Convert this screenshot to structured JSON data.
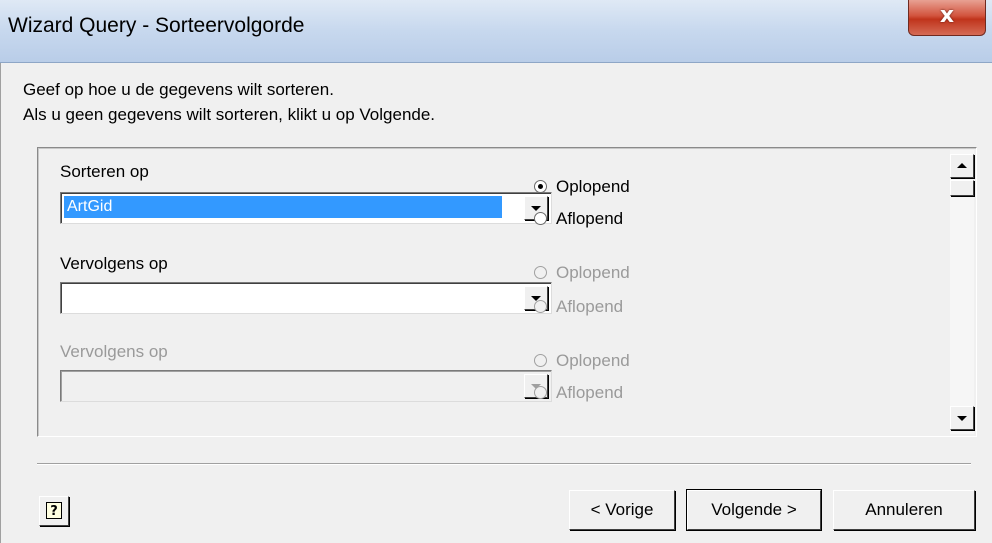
{
  "window": {
    "title": "Wizard Query - Sorteervolgorde",
    "close_label": "x"
  },
  "intro": {
    "line1": "Geef op hoe u de gegevens wilt sorteren.",
    "line2": "Als u geen gegevens wilt sorteren, klikt u op Volgende."
  },
  "sort_groups": [
    {
      "label": "Sorteren op",
      "value": "ArtGid",
      "enabled": true,
      "options": {
        "asc": "Oplopend",
        "desc": "Aflopend"
      },
      "selected": "asc"
    },
    {
      "label": "Vervolgens op",
      "value": "",
      "enabled": true,
      "options": {
        "asc": "Oplopend",
        "desc": "Aflopend"
      },
      "selected": null
    },
    {
      "label": "Vervolgens op",
      "value": "",
      "enabled": false,
      "options": {
        "asc": "Oplopend",
        "desc": "Aflopend"
      },
      "selected": null
    }
  ],
  "buttons": {
    "help": "?",
    "prev": "< Vorige",
    "next": "Volgende >",
    "cancel": "Annuleren"
  },
  "colors": {
    "selection": "#3399ff",
    "titlebar": "#c7d8ee",
    "close": "#c0341c"
  }
}
